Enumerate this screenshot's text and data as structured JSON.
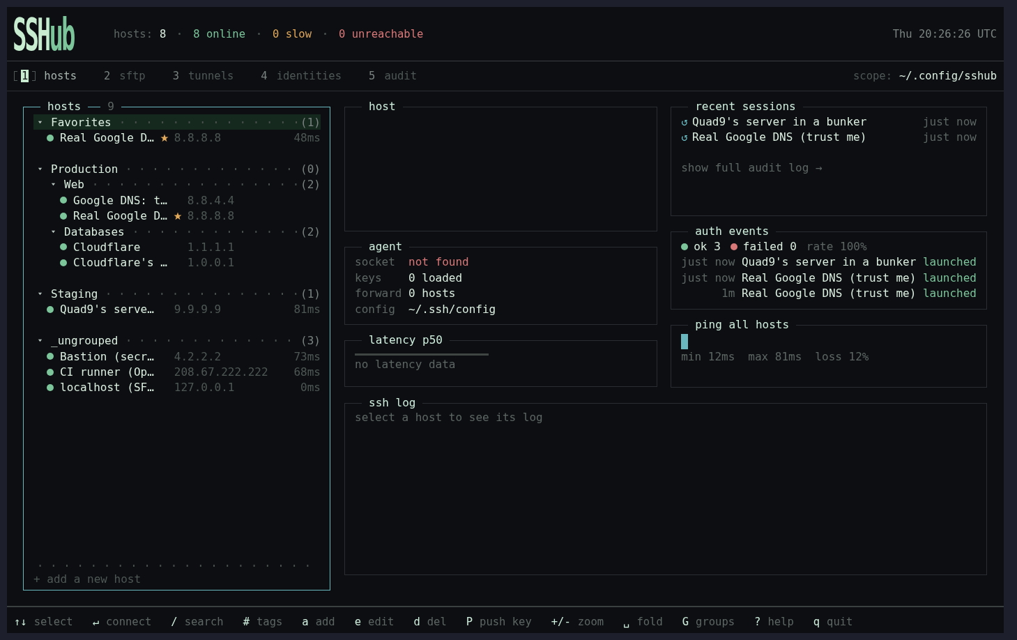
{
  "logo": "SSHub",
  "stats": {
    "label": "hosts:",
    "total": "8",
    "items": [
      {
        "kind": "online",
        "text": "8 online"
      },
      {
        "kind": "slow",
        "text": "0 slow"
      },
      {
        "kind": "unreachable",
        "text": "0 unreachable"
      }
    ]
  },
  "clock": "Thu 20:26:26 UTC",
  "tabs": [
    {
      "key": "1",
      "label": "hosts",
      "selected": true
    },
    {
      "key": "2",
      "label": "sftp",
      "selected": false
    },
    {
      "key": "3",
      "label": "tunnels",
      "selected": false
    },
    {
      "key": "4",
      "label": "identities",
      "selected": false
    },
    {
      "key": "5",
      "label": "audit",
      "selected": false
    }
  ],
  "scope": {
    "label": "scope:",
    "value": "~/.config/sshub"
  },
  "hosts_panel": {
    "title": "hosts",
    "count": "9",
    "focused": true,
    "add_label": "+ add a new host",
    "tree": [
      {
        "kind": "group",
        "label": "Favorites",
        "count": "(1)",
        "expanded": true,
        "selected": true,
        "children": [
          {
            "kind": "host",
            "name": "Real Google D…",
            "favorite": true,
            "address": "8.8.8.8",
            "latency": "48ms",
            "color": "#7cc49a",
            "selected": false
          }
        ]
      },
      {
        "kind": "group",
        "label": "Production",
        "count": "(0)",
        "expanded": true,
        "selected": false,
        "children": [
          {
            "kind": "group",
            "label": "Web",
            "count": "(2)",
            "expanded": true,
            "selected": false,
            "children": [
              {
                "kind": "host",
                "name": "Google DNS: t…",
                "favorite": false,
                "address": "8.8.4.4",
                "color": "#7cc49a",
                "selected": false
              },
              {
                "kind": "host",
                "name": "Real Google D…",
                "favorite": true,
                "address": "8.8.8.8",
                "color": "#7cc49a",
                "selected": false
              }
            ]
          },
          {
            "kind": "group",
            "label": "Databases",
            "count": "(2)",
            "expanded": true,
            "selected": false,
            "children": [
              {
                "kind": "host",
                "name": "Cloudflare",
                "favorite": false,
                "address": "1.1.1.1",
                "color": "#7cc49a",
                "selected": false
              },
              {
                "kind": "host",
                "name": "Cloudflare's …",
                "favorite": false,
                "address": "1.0.0.1",
                "color": "#7cc49a",
                "selected": false
              }
            ]
          }
        ]
      },
      {
        "kind": "group",
        "label": "Staging",
        "count": "(1)",
        "expanded": true,
        "selected": false,
        "children": [
          {
            "kind": "host",
            "name": "Quad9's serve…",
            "favorite": false,
            "address": "9.9.9.9",
            "latency": "81ms",
            "color": "#7cc49a",
            "selected": false
          }
        ]
      },
      {
        "kind": "group",
        "label": "_ungrouped",
        "count": "(3)",
        "expanded": true,
        "selected": false,
        "children": [
          {
            "kind": "host",
            "name": "Bastion (secr…",
            "favorite": false,
            "address": "4.2.2.2",
            "latency": "73ms",
            "color": "#7cc49a",
            "selected": false
          },
          {
            "kind": "host",
            "name": "CI runner (Op…",
            "favorite": false,
            "address": "208.67.222.222",
            "latency": "68ms",
            "color": "#7cc49a",
            "selected": false
          },
          {
            "kind": "host",
            "name": "localhost (SF…",
            "favorite": false,
            "address": "127.0.0.1",
            "latency": "0ms",
            "color": "#7cc49a",
            "selected": false
          }
        ]
      }
    ]
  },
  "host_panel": {
    "title": "host"
  },
  "agent": {
    "title": "agent",
    "rows": [
      {
        "label": "socket",
        "value": "not found",
        "kind": "error"
      },
      {
        "label": "keys",
        "value": "0 loaded",
        "kind": "normal"
      },
      {
        "label": "forward",
        "value": "0 hosts",
        "kind": "normal"
      },
      {
        "label": "config",
        "value": "~/.ssh/config",
        "kind": "normal"
      }
    ]
  },
  "latency": {
    "title": "latency p50",
    "empty_text": "no latency data"
  },
  "recent_sessions": {
    "title": "recent sessions",
    "link": "show full audit log →",
    "items": [
      {
        "icon": "↺",
        "name": "Quad9's server in a bunker",
        "time": "just now"
      },
      {
        "icon": "↺",
        "name": "Real Google DNS (trust me)",
        "time": "just now"
      }
    ]
  },
  "auth_events": {
    "title": "auth events",
    "summary": [
      {
        "kind": "ok",
        "text": "ok 3"
      },
      {
        "kind": "failed",
        "text": "failed 0"
      },
      {
        "kind": "rate",
        "text": "rate 100%"
      }
    ],
    "events": [
      {
        "time": "just now",
        "host": "Quad9's server in a bunker",
        "action": "launched"
      },
      {
        "time": "just now",
        "host": "Real Google DNS (trust me)",
        "action": "launched"
      },
      {
        "time": "1m",
        "host": "Real Google DNS (trust me)",
        "action": "launched"
      }
    ]
  },
  "ping": {
    "title": "ping all hosts",
    "level": 0.024,
    "stats": [
      {
        "label": "min",
        "value": "12ms"
      },
      {
        "label": "max",
        "value": "81ms"
      },
      {
        "label": "loss",
        "value": "12%"
      }
    ]
  },
  "ssh_log": {
    "title": "ssh log",
    "placeholder": "select a host to see its log"
  },
  "keys": [
    {
      "key": "↑↓",
      "label": "select"
    },
    {
      "key": "↵",
      "label": "connect"
    },
    {
      "key": "/",
      "label": "search"
    },
    {
      "key": "#",
      "label": "tags"
    },
    {
      "key": "a",
      "label": "add"
    },
    {
      "key": "e",
      "label": "edit"
    },
    {
      "key": "d",
      "label": "del"
    },
    {
      "key": "P",
      "label": "push key"
    },
    {
      "key": "+/-",
      "label": "zoom"
    },
    {
      "key": "␣",
      "label": "fold"
    },
    {
      "key": "G",
      "label": "groups"
    },
    {
      "key": "?",
      "label": "help"
    },
    {
      "key": "q",
      "label": "quit"
    }
  ]
}
